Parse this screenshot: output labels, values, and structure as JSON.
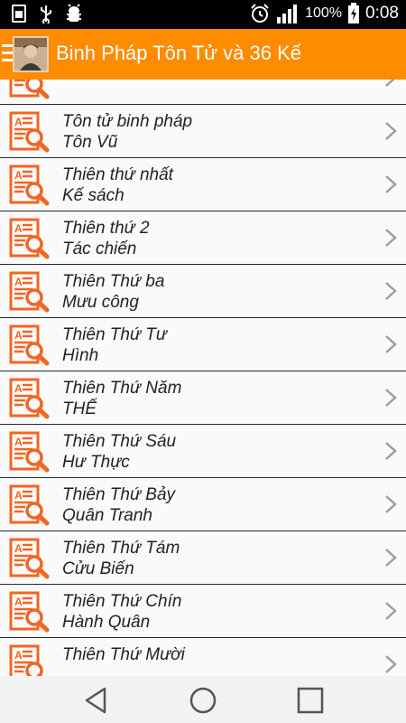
{
  "status_bar": {
    "icons": [
      "sim-card-icon",
      "usb-icon",
      "android-debug-icon",
      "alarm-icon",
      "signal-icon",
      "battery-charging-icon"
    ],
    "battery": "100%",
    "time": "0:08"
  },
  "app_bar": {
    "title": "Binh Pháp Tôn Tử và 36 Kế",
    "icons": [
      "menu-icon",
      "avatar"
    ]
  },
  "list": {
    "item_icon": "document-search-icon",
    "trailing_icon": "chevron-right-icon",
    "items": [
      {
        "title": "",
        "subtitle": ""
      },
      {
        "title": "Tôn tử binh pháp",
        "subtitle": "Tôn Vũ"
      },
      {
        "title": "Thiên thứ nhất",
        "subtitle": "Kế sách"
      },
      {
        "title": "Thiên thứ 2",
        "subtitle": "Tác chiến"
      },
      {
        "title": "Thiên Thứ ba",
        "subtitle": "Mưu công"
      },
      {
        "title": "Thiên Thứ Tư",
        "subtitle": "Hình"
      },
      {
        "title": "Thiên Thứ Năm",
        "subtitle": "THẾ"
      },
      {
        "title": "Thiên Thứ Sáu",
        "subtitle": "Hư Thực"
      },
      {
        "title": "Thiên Thứ Bảy",
        "subtitle": "Quân Tranh"
      },
      {
        "title": "Thiên Thứ Tám",
        "subtitle": "Cửu Biến"
      },
      {
        "title": "Thiên Thứ Chín",
        "subtitle": "Hành Quân"
      },
      {
        "title": "Thiên Thứ Mười",
        "subtitle": ""
      }
    ]
  },
  "nav_bar": {
    "icons": [
      "back-icon",
      "home-icon",
      "recents-icon"
    ]
  },
  "colors": {
    "accent": "#ff8c00",
    "icon_orange": "#f26522",
    "list_bg": "#fafafa",
    "divider": "#2a2a2a"
  }
}
